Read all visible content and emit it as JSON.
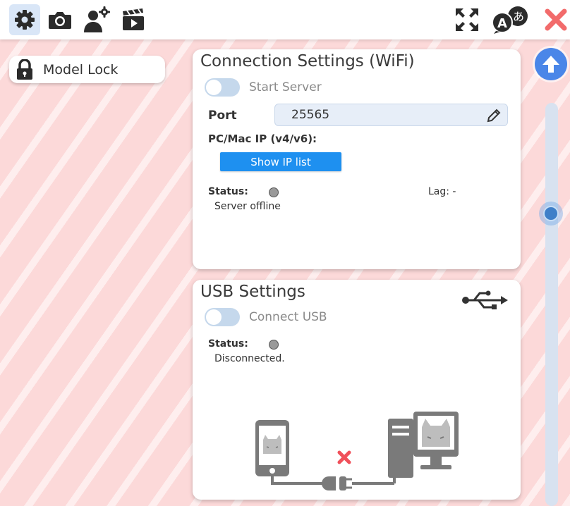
{
  "toolbar": {
    "left_icons": [
      "gear-icon",
      "camera-icon",
      "user-settings-icon",
      "clapperboard-icon"
    ],
    "right_icons": [
      "expand-arrows-icon",
      "language-icon",
      "close-icon"
    ],
    "language_glyph_latin": "A",
    "language_glyph_kana": "あ",
    "colors": {
      "active_bg": "#d9e6f7",
      "close": "#f26b6b",
      "icon": "#2b2b2b"
    }
  },
  "model_lock": {
    "label": "Model Lock",
    "icon": "lock-icon"
  },
  "wifi": {
    "title": "Connection Settings (WiFi)",
    "start_server_label": "Start Server",
    "start_server_on": false,
    "port_label": "Port",
    "port_value": "25565",
    "ip_label": "PC/Mac IP (v4/v6):",
    "show_ip_button": "Show IP list",
    "status_label": "Status:",
    "status_text": "Server offline",
    "lag_label": "Lag: -"
  },
  "usb": {
    "title": "USB Settings",
    "connect_label": "Connect USB",
    "connect_on": false,
    "status_label": "Status:",
    "status_text": "Disconnected.",
    "icon": "usb-icon",
    "illustration": "phone-pc-disconnected-illustration"
  },
  "colors": {
    "background": "#fcd9d9",
    "accent": "#1e90f0",
    "toggle_off": "#c5d8ec",
    "scroll_button": "#4a86e8",
    "disconnected_x": "#f0505a"
  }
}
